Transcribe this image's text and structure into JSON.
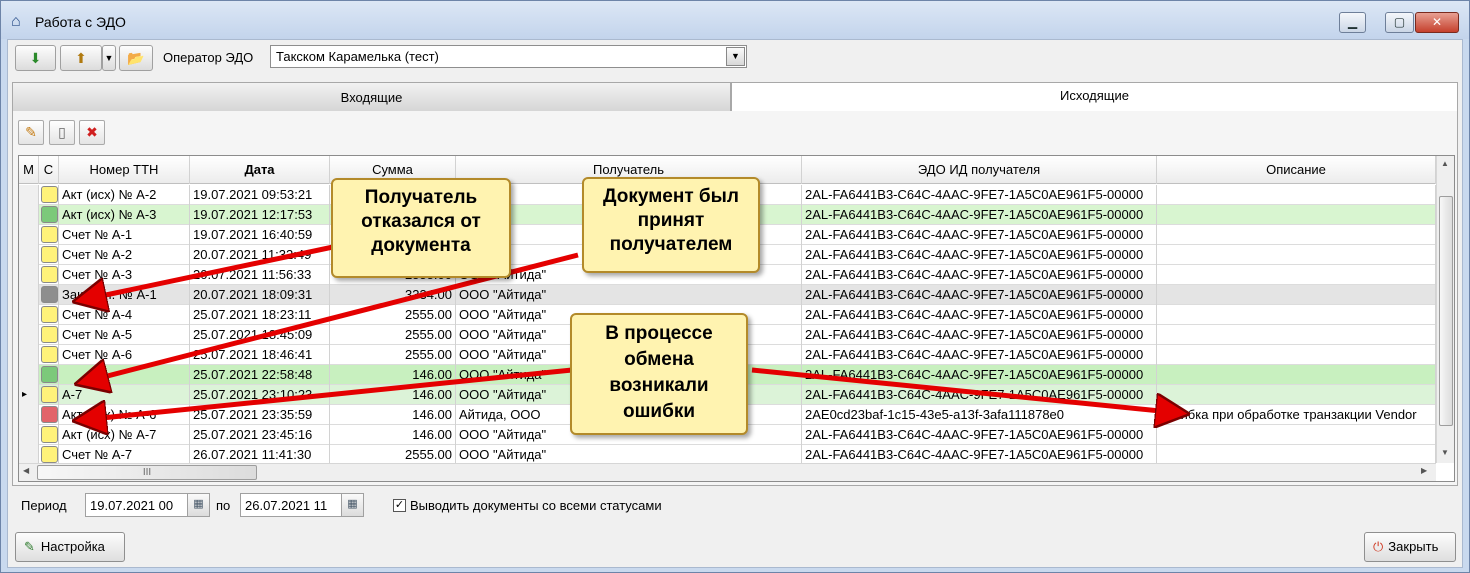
{
  "window": {
    "title": "Работа с ЭДО"
  },
  "toolbar": {
    "operator_label": "Оператор ЭДО",
    "operator_value": "Такском Карамелька (тест)"
  },
  "tabs": [
    {
      "label": "Входящие",
      "active": false
    },
    {
      "label": "Исходящие",
      "active": true
    }
  ],
  "grid": {
    "columns": [
      "М",
      "С",
      "Номер ТТН",
      "Дата",
      "Сумма",
      "Получатель",
      "ЭДО ИД  получателя",
      "Описание"
    ],
    "rows": [
      {
        "status": "yellow",
        "num": "Акт (исх) № А-2",
        "date": "19.07.2021 09:53:21",
        "sum": "",
        "recipient": "Айтида\"",
        "edo": "2AL-FA6441B3-C64C-4AAC-9FE7-1A5C0AE961F5-00000",
        "desc": "",
        "bg": "#ffffff"
      },
      {
        "status": "green",
        "num": "Акт (исх) № А-3",
        "date": "19.07.2021 12:17:53",
        "sum": "",
        "recipient": "Айтида\"",
        "edo": "2AL-FA6441B3-C64C-4AAC-9FE7-1A5C0AE961F5-00000",
        "desc": "",
        "bg": "#d8f5d0"
      },
      {
        "status": "yellow",
        "num": "Счет № А-1",
        "date": "19.07.2021 16:40:59",
        "sum": "",
        "recipient": "Айтида\"",
        "edo": "2AL-FA6441B3-C64C-4AAC-9FE7-1A5C0AE961F5-00000",
        "desc": "",
        "bg": "#ffffff"
      },
      {
        "status": "yellow",
        "num": "Счет № А-2",
        "date": "20.07.2021 11:32:49",
        "sum": "",
        "recipient": "Айтида\"",
        "edo": "2AL-FA6441B3-C64C-4AAC-9FE7-1A5C0AE961F5-00000",
        "desc": "",
        "bg": "#ffffff"
      },
      {
        "status": "yellow",
        "num": "Счет № А-3",
        "date": "20.07.2021 11:56:33",
        "sum": "2555.00",
        "recipient": "ООО \"Айтида\"",
        "edo": "2AL-FA6441B3-C64C-4AAC-9FE7-1A5C0AE961F5-00000",
        "desc": "",
        "bg": "#ffffff"
      },
      {
        "status": "gray",
        "num": "Зак.пост. № А-1",
        "date": "20.07.2021 18:09:31",
        "sum": "3334.00",
        "recipient": "ООО \"Айтида\"",
        "edo": "2AL-FA6441B3-C64C-4AAC-9FE7-1A5C0AE961F5-00000",
        "desc": "",
        "bg": "#e4e4e4"
      },
      {
        "status": "yellow",
        "num": "Счет № А-4",
        "date": "25.07.2021 18:23:11",
        "sum": "2555.00",
        "recipient": "ООО \"Айтида\"",
        "edo": "2AL-FA6441B3-C64C-4AAC-9FE7-1A5C0AE961F5-00000",
        "desc": "",
        "bg": "#ffffff"
      },
      {
        "status": "yellow",
        "num": "Счет № А-5",
        "date": "25.07.2021 18:45:09",
        "sum": "2555.00",
        "recipient": "ООО \"Айтида\"",
        "edo": "2AL-FA6441B3-C64C-4AAC-9FE7-1A5C0AE961F5-00000",
        "desc": "",
        "bg": "#ffffff"
      },
      {
        "status": "yellow",
        "num": "Счет № А-6",
        "date": "25.07.2021 18:46:41",
        "sum": "2555.00",
        "recipient": "ООО \"Айтида\"",
        "edo": "2AL-FA6441B3-C64C-4AAC-9FE7-1A5C0AE961F5-00000",
        "desc": "",
        "bg": "#ffffff"
      },
      {
        "status": "green",
        "num": "",
        "date": "25.07.2021 22:58:48",
        "sum": "146.00",
        "recipient": "ООО \"Айтида\"",
        "edo": "2AL-FA6441B3-C64C-4AAC-9FE7-1A5C0AE961F5-00000",
        "desc": "",
        "bg": "#c8f0bf"
      },
      {
        "status": "yellow",
        "num": "А-7",
        "date": "25.07.2021 23:10:23",
        "sum": "146.00",
        "recipient": "ООО \"Айтида\"",
        "edo": "2AL-FA6441B3-C64C-4AAC-9FE7-1A5C0AE961F5-00000",
        "desc": "",
        "bg": "#dcf3d8"
      },
      {
        "status": "red",
        "num": "Акт (исх) № А-6",
        "date": "25.07.2021 23:35:59",
        "sum": "146.00",
        "recipient": "Айтида, ООО",
        "edo": "2AE0cd23baf-1c15-43e5-a13f-3afa111878e0",
        "desc": "Ошибка при обработке транзакции Vendor",
        "bg": "#ffffff"
      },
      {
        "status": "yellow",
        "num": "Акт (исх) № А-7",
        "date": "25.07.2021 23:45:16",
        "sum": "146.00",
        "recipient": "ООО \"Айтида\"",
        "edo": "2AL-FA6441B3-C64C-4AAC-9FE7-1A5C0AE961F5-00000",
        "desc": "",
        "bg": "#ffffff"
      },
      {
        "status": "yellow",
        "num": "Счет № А-7",
        "date": "26.07.2021 11:41:30",
        "sum": "2555.00",
        "recipient": "ООО \"Айтида\"",
        "edo": "2AL-FA6441B3-C64C-4AAC-9FE7-1A5C0AE961F5-00000",
        "desc": "",
        "bg": "#ffffff"
      }
    ],
    "hscroll_glyph": "III"
  },
  "status_colors": {
    "yellow": "#fff27a",
    "green": "#7cc97a",
    "gray": "#8e8e8e",
    "red": "#e2646a"
  },
  "period": {
    "label": "Период",
    "from": "19.07.2021 00",
    "to_label": "по",
    "to": "26.07.2021 11",
    "show_all_label": "Выводить документы со всеми статусами",
    "show_all_checked": true
  },
  "buttons": {
    "settings": "Настройка",
    "close": "Закрыть"
  },
  "callouts": {
    "rejected": "Получатель отказался от документа",
    "accepted": "Документ был принят получателем",
    "errors": "В процессе обмена возникали ошибки"
  }
}
